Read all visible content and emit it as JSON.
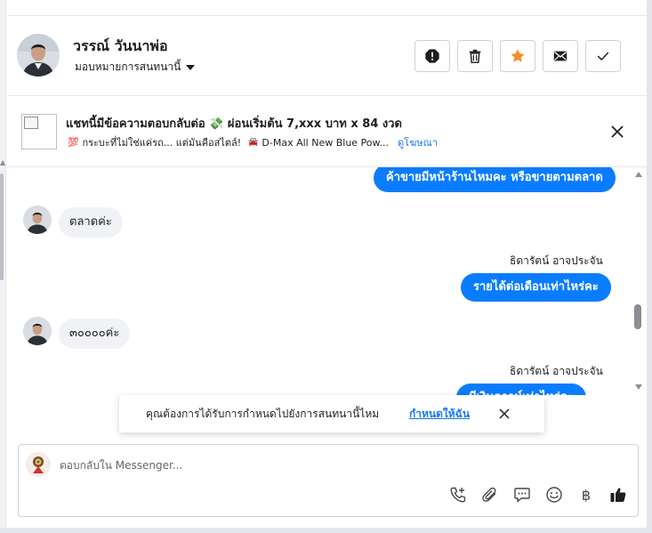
{
  "header": {
    "contact_name": "วรรณ์ วันนาพ่อ",
    "assign_label": "มอบหมายการสนทนานี้"
  },
  "ad": {
    "title_text": "แชทนี้มีข้อความตอบกลับต่อ",
    "title_money": "💸",
    "title_suffix": "ผ่อนเริ่มต้น 7,xxx บาท x 84 งวด",
    "sub_heart": "💯",
    "sub_text1": "กระบะที่ไม่ใช่แค่รถ... แต่มันคือสไตล์!",
    "sub_car": "🚘",
    "sub_text2": "D-Max All New Blue Pow...",
    "link": "ดูโฆษณา"
  },
  "messages": {
    "m1": "ค้าขายมีหน้าร้านไหมคะ หรือขายตามตลาด",
    "m2": "ตลาดค่ะ",
    "sender1": "ธิดารัตน์ อาจประจัน",
    "m3": "รายได้ต่อเดือนเท่าไหร่คะ",
    "m4": "๓๐๐๐๐ค่ะ",
    "sender2": "ธิดารัตน์ อาจประจัน",
    "m5": "มีเงินดาวน์เท่าไหร่คะ"
  },
  "toast": {
    "text": "คุณต้องการได้รับการกำหนดไปยังการสนทนานี้ไหม",
    "link": "กำหนดให้ฉัน"
  },
  "composer": {
    "placeholder": "ตอบกลับใน Messenger...",
    "baht_symbol": "฿"
  },
  "icons": {
    "actions": [
      "alert-icon",
      "trash-icon",
      "star-icon",
      "envelope-icon",
      "check-icon"
    ],
    "tools": [
      "phone-plus-icon",
      "paperclip-icon",
      "quick-reply-icon",
      "emoji-icon",
      "baht-icon",
      "thumbs-up-icon"
    ]
  },
  "colors": {
    "accent": "#0a7cff",
    "link": "#1877f2",
    "star": "#f28c28"
  }
}
